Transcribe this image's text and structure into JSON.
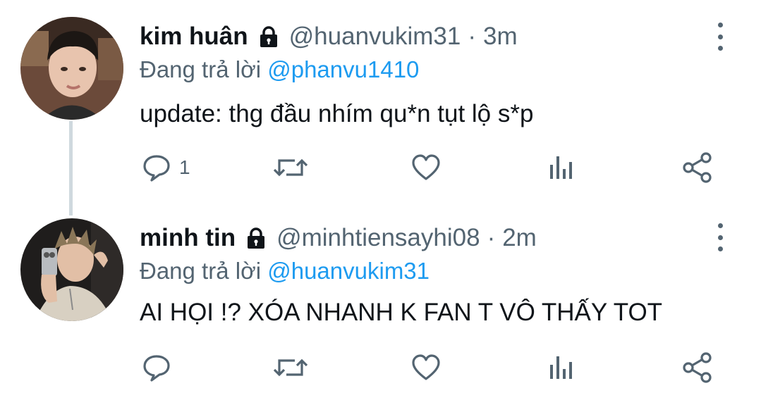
{
  "tweets": [
    {
      "display_name": "kim huân",
      "handle": "@huanvukim31",
      "separator": "·",
      "time": "3m",
      "reply_prefix": "Đang trả lời",
      "reply_to": "@phanvu1410",
      "text": "update: thg đầu nhím qu*n tụt lộ s*p",
      "reply_count": "1",
      "retweet_count": "",
      "like_count": "",
      "view_count": ""
    },
    {
      "display_name": "minh tin",
      "handle": "@minhtiensayhi08",
      "separator": "·",
      "time": "2m",
      "reply_prefix": "Đang trả lời",
      "reply_to": "@huanvukim31",
      "text": "AI HỌI !? XÓA NHANH K FAN T VÔ THẤY TOT",
      "reply_count": "",
      "retweet_count": "",
      "like_count": "",
      "view_count": ""
    }
  ],
  "icons": {
    "lock": "lock-icon",
    "more": "more-vertical-icon",
    "reply": "reply-icon",
    "retweet": "retweet-icon",
    "like": "heart-icon",
    "views": "views-icon",
    "share": "share-icon"
  },
  "colors": {
    "text": "#0f1419",
    "secondary": "#536471",
    "link": "#1d9bf0",
    "thread_line": "#cfd9de"
  }
}
